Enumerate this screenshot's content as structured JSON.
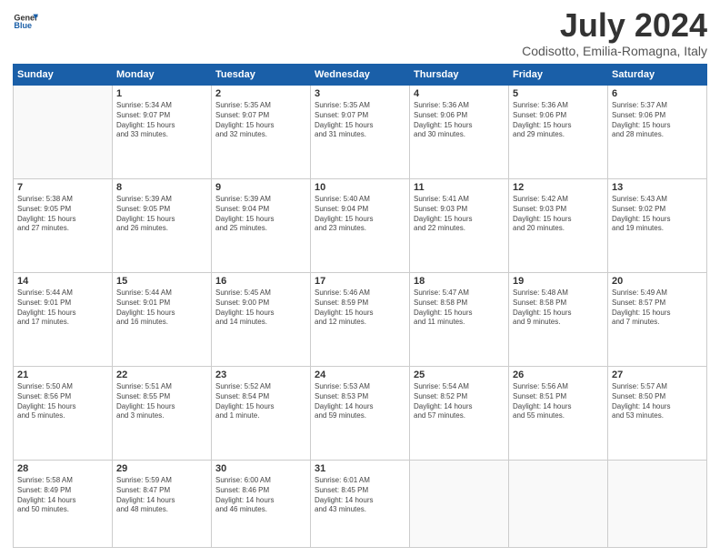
{
  "header": {
    "logo_line1": "General",
    "logo_line2": "Blue",
    "month": "July 2024",
    "location": "Codisotto, Emilia-Romagna, Italy"
  },
  "weekdays": [
    "Sunday",
    "Monday",
    "Tuesday",
    "Wednesday",
    "Thursday",
    "Friday",
    "Saturday"
  ],
  "weeks": [
    [
      {
        "day": "",
        "info": ""
      },
      {
        "day": "1",
        "info": "Sunrise: 5:34 AM\nSunset: 9:07 PM\nDaylight: 15 hours\nand 33 minutes."
      },
      {
        "day": "2",
        "info": "Sunrise: 5:35 AM\nSunset: 9:07 PM\nDaylight: 15 hours\nand 32 minutes."
      },
      {
        "day": "3",
        "info": "Sunrise: 5:35 AM\nSunset: 9:07 PM\nDaylight: 15 hours\nand 31 minutes."
      },
      {
        "day": "4",
        "info": "Sunrise: 5:36 AM\nSunset: 9:06 PM\nDaylight: 15 hours\nand 30 minutes."
      },
      {
        "day": "5",
        "info": "Sunrise: 5:36 AM\nSunset: 9:06 PM\nDaylight: 15 hours\nand 29 minutes."
      },
      {
        "day": "6",
        "info": "Sunrise: 5:37 AM\nSunset: 9:06 PM\nDaylight: 15 hours\nand 28 minutes."
      }
    ],
    [
      {
        "day": "7",
        "info": "Sunrise: 5:38 AM\nSunset: 9:05 PM\nDaylight: 15 hours\nand 27 minutes."
      },
      {
        "day": "8",
        "info": "Sunrise: 5:39 AM\nSunset: 9:05 PM\nDaylight: 15 hours\nand 26 minutes."
      },
      {
        "day": "9",
        "info": "Sunrise: 5:39 AM\nSunset: 9:04 PM\nDaylight: 15 hours\nand 25 minutes."
      },
      {
        "day": "10",
        "info": "Sunrise: 5:40 AM\nSunset: 9:04 PM\nDaylight: 15 hours\nand 23 minutes."
      },
      {
        "day": "11",
        "info": "Sunrise: 5:41 AM\nSunset: 9:03 PM\nDaylight: 15 hours\nand 22 minutes."
      },
      {
        "day": "12",
        "info": "Sunrise: 5:42 AM\nSunset: 9:03 PM\nDaylight: 15 hours\nand 20 minutes."
      },
      {
        "day": "13",
        "info": "Sunrise: 5:43 AM\nSunset: 9:02 PM\nDaylight: 15 hours\nand 19 minutes."
      }
    ],
    [
      {
        "day": "14",
        "info": "Sunrise: 5:44 AM\nSunset: 9:01 PM\nDaylight: 15 hours\nand 17 minutes."
      },
      {
        "day": "15",
        "info": "Sunrise: 5:44 AM\nSunset: 9:01 PM\nDaylight: 15 hours\nand 16 minutes."
      },
      {
        "day": "16",
        "info": "Sunrise: 5:45 AM\nSunset: 9:00 PM\nDaylight: 15 hours\nand 14 minutes."
      },
      {
        "day": "17",
        "info": "Sunrise: 5:46 AM\nSunset: 8:59 PM\nDaylight: 15 hours\nand 12 minutes."
      },
      {
        "day": "18",
        "info": "Sunrise: 5:47 AM\nSunset: 8:58 PM\nDaylight: 15 hours\nand 11 minutes."
      },
      {
        "day": "19",
        "info": "Sunrise: 5:48 AM\nSunset: 8:58 PM\nDaylight: 15 hours\nand 9 minutes."
      },
      {
        "day": "20",
        "info": "Sunrise: 5:49 AM\nSunset: 8:57 PM\nDaylight: 15 hours\nand 7 minutes."
      }
    ],
    [
      {
        "day": "21",
        "info": "Sunrise: 5:50 AM\nSunset: 8:56 PM\nDaylight: 15 hours\nand 5 minutes."
      },
      {
        "day": "22",
        "info": "Sunrise: 5:51 AM\nSunset: 8:55 PM\nDaylight: 15 hours\nand 3 minutes."
      },
      {
        "day": "23",
        "info": "Sunrise: 5:52 AM\nSunset: 8:54 PM\nDaylight: 15 hours\nand 1 minute."
      },
      {
        "day": "24",
        "info": "Sunrise: 5:53 AM\nSunset: 8:53 PM\nDaylight: 14 hours\nand 59 minutes."
      },
      {
        "day": "25",
        "info": "Sunrise: 5:54 AM\nSunset: 8:52 PM\nDaylight: 14 hours\nand 57 minutes."
      },
      {
        "day": "26",
        "info": "Sunrise: 5:56 AM\nSunset: 8:51 PM\nDaylight: 14 hours\nand 55 minutes."
      },
      {
        "day": "27",
        "info": "Sunrise: 5:57 AM\nSunset: 8:50 PM\nDaylight: 14 hours\nand 53 minutes."
      }
    ],
    [
      {
        "day": "28",
        "info": "Sunrise: 5:58 AM\nSunset: 8:49 PM\nDaylight: 14 hours\nand 50 minutes."
      },
      {
        "day": "29",
        "info": "Sunrise: 5:59 AM\nSunset: 8:47 PM\nDaylight: 14 hours\nand 48 minutes."
      },
      {
        "day": "30",
        "info": "Sunrise: 6:00 AM\nSunset: 8:46 PM\nDaylight: 14 hours\nand 46 minutes."
      },
      {
        "day": "31",
        "info": "Sunrise: 6:01 AM\nSunset: 8:45 PM\nDaylight: 14 hours\nand 43 minutes."
      },
      {
        "day": "",
        "info": ""
      },
      {
        "day": "",
        "info": ""
      },
      {
        "day": "",
        "info": ""
      }
    ]
  ]
}
